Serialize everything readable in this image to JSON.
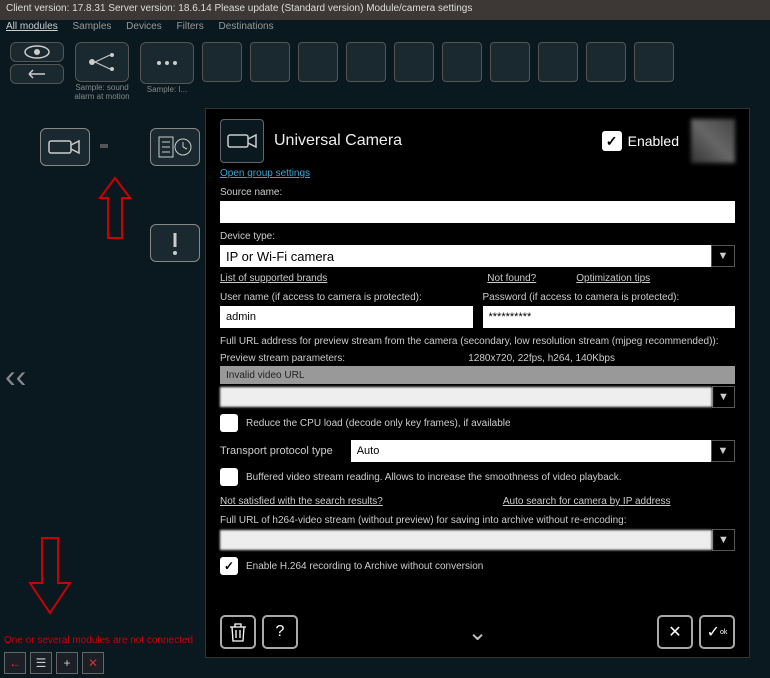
{
  "title_bar": "Client version: 17.8.31 Server version: 18.6.14 Please update (Standard version) Module/camera settings",
  "menu": {
    "all_modules": "All modules",
    "samples": "Samples",
    "devices": "Devices",
    "filters": "Filters",
    "destinations": "Destinations"
  },
  "toolbar": {
    "sample1": "Sample: sound alarm at motion",
    "sample2": "Sample: I..."
  },
  "dialog": {
    "title": "Universal Camera",
    "enabled_label": "Enabled",
    "open_group": "Open group settings",
    "source_name_label": "Source name:",
    "source_name": "",
    "device_type_label": "Device type:",
    "device_type": "IP or Wi-Fi camera",
    "list_brands": "List of supported brands",
    "not_found": "Not found?",
    "opt_tips": "Optimization tips",
    "username_label": "User name (if access to camera is protected):",
    "username": "admin",
    "password_label": "Password (if access to camera is protected):",
    "password": "**********",
    "full_url_label": "Full URL address for preview stream from the camera (secondary, low resolution stream (mjpeg recommended)):",
    "preview_params_label": "Preview stream parameters:",
    "preview_params_value": "1280x720, 22fps, h264, 140Kbps",
    "invalid_url": "Invalid video URL",
    "reduce_cpu": "Reduce the CPU load (decode only key frames), if available",
    "transport_label": "Transport protocol type",
    "transport_value": "Auto",
    "buffered": "Buffered video stream reading. Allows to increase the smoothness of video playback.",
    "not_satisfied": "Not satisfied with the search results?",
    "auto_search": "Auto search for camera by IP address",
    "h264_label": "Full URL of h264-video stream (without preview) for saving into archive without re-encoding:",
    "enable_h264": "Enable H.264 recording to Archive without conversion"
  },
  "error": "One or several modules are not connected"
}
